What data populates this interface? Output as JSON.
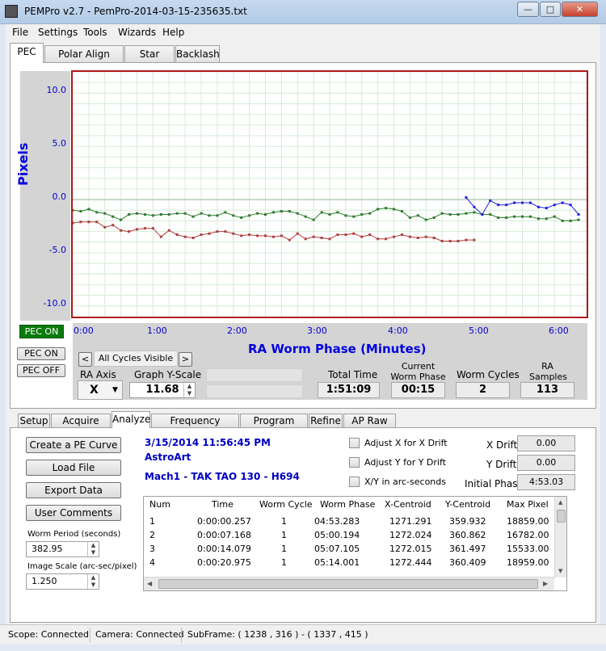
{
  "window": {
    "title": "PEMPro v2.7 - PemPro-2014-03-15-235635.txt",
    "min": "—",
    "max": "□",
    "close": "✕"
  },
  "menu": [
    "File",
    "Settings",
    "Tools",
    "Wizards",
    "Help"
  ],
  "main_tabs": [
    "PEC",
    "Polar Align Wizard",
    "Star Finder",
    "Backlash"
  ],
  "chart": {
    "ylabel": "Pixels",
    "xlabel": "RA Worm Phase (Minutes)",
    "yticks": [
      "10.0",
      "5.0",
      "0.0",
      "-5.0",
      "-10.0"
    ],
    "xticks": [
      "0:00",
      "1:00",
      "2:00",
      "3:00",
      "4:00",
      "5:00",
      "6:00"
    ]
  },
  "chart_data": {
    "type": "line",
    "title": "",
    "xlabel": "RA Worm Phase (Minutes)",
    "ylabel": "Pixels",
    "xlim": [
      0,
      6.4
    ],
    "ylim": [
      -11,
      12
    ],
    "grid": true,
    "series": [
      {
        "color": "#2e7d2e",
        "x": [
          0,
          0.1,
          0.2,
          0.3,
          0.4,
          0.5,
          0.6,
          0.7,
          0.8,
          0.9,
          1.0,
          1.1,
          1.2,
          1.3,
          1.4,
          1.5,
          1.6,
          1.7,
          1.8,
          1.9,
          2.0,
          2.1,
          2.2,
          2.3,
          2.4,
          2.5,
          2.6,
          2.7,
          2.8,
          2.9,
          3.0,
          3.1,
          3.2,
          3.3,
          3.4,
          3.5,
          3.6,
          3.7,
          3.8,
          3.9,
          4.0,
          4.1,
          4.2,
          4.3,
          4.4,
          4.5,
          4.6,
          4.7,
          4.8,
          4.9,
          5.0,
          5.1,
          5.2,
          5.3,
          5.4,
          5.5,
          5.6,
          5.7,
          5.8,
          5.9,
          6.0,
          6.1,
          6.2,
          6.3
        ],
        "y": [
          -1.0,
          -1.1,
          -0.9,
          -1.2,
          -1.3,
          -1.6,
          -1.9,
          -1.4,
          -1.3,
          -1.4,
          -1.5,
          -1.4,
          -1.4,
          -1.3,
          -1.3,
          -1.6,
          -1.3,
          -1.5,
          -1.5,
          -1.2,
          -1.5,
          -1.7,
          -1.5,
          -1.3,
          -1.4,
          -1.2,
          -1.1,
          -1.1,
          -1.3,
          -1.6,
          -1.9,
          -1.2,
          -1.4,
          -1.2,
          -1.5,
          -1.6,
          -1.4,
          -1.3,
          -0.9,
          -0.8,
          -0.9,
          -1.1,
          -1.7,
          -1.5,
          -1.9,
          -1.7,
          -1.3,
          -1.4,
          -1.4,
          -1.3,
          -1.2,
          -1.4,
          -1.4,
          -1.7,
          -1.7,
          -1.6,
          -1.6,
          -1.6,
          -1.8,
          -1.8,
          -1.6,
          -2.0,
          -2.0,
          -1.9
        ]
      },
      {
        "color": "#b04040",
        "x": [
          0,
          0.1,
          0.2,
          0.3,
          0.4,
          0.5,
          0.6,
          0.7,
          0.8,
          0.9,
          1.0,
          1.1,
          1.2,
          1.3,
          1.4,
          1.5,
          1.6,
          1.7,
          1.8,
          1.9,
          2.0,
          2.1,
          2.2,
          2.3,
          2.4,
          2.5,
          2.6,
          2.7,
          2.8,
          2.9,
          3.0,
          3.1,
          3.2,
          3.3,
          3.4,
          3.5,
          3.6,
          3.7,
          3.8,
          3.9,
          4.0,
          4.1,
          4.2,
          4.3,
          4.4,
          4.5,
          4.6,
          4.7,
          4.8,
          4.9,
          5.0
        ],
        "y": [
          -2.2,
          -2.1,
          -2.1,
          -2.1,
          -2.6,
          -2.4,
          -2.9,
          -3.0,
          -2.8,
          -2.7,
          -2.7,
          -3.5,
          -2.9,
          -3.3,
          -3.5,
          -3.6,
          -3.3,
          -3.2,
          -3.0,
          -3.0,
          -3.2,
          -3.4,
          -3.3,
          -3.4,
          -3.4,
          -3.5,
          -3.4,
          -3.8,
          -3.2,
          -3.7,
          -3.5,
          -3.6,
          -3.7,
          -3.3,
          -3.3,
          -3.2,
          -3.5,
          -3.3,
          -3.7,
          -3.7,
          -3.5,
          -3.3,
          -3.5,
          -3.6,
          -3.5,
          -3.6,
          -3.9,
          -3.9,
          -3.9,
          -3.8,
          -3.8
        ]
      },
      {
        "color": "#2020e0",
        "x": [
          4.9,
          5.0,
          5.1,
          5.2,
          5.3,
          5.4,
          5.5,
          5.6,
          5.7,
          5.8,
          5.9,
          6.0,
          6.1,
          6.2,
          6.3
        ],
        "y": [
          0.2,
          -0.7,
          -1.4,
          -0.1,
          -0.5,
          -0.5,
          -0.3,
          -0.3,
          -0.3,
          -0.7,
          -0.8,
          -0.5,
          -0.3,
          -0.5,
          -1.4
        ]
      }
    ]
  },
  "pec": {
    "status": "PEC ON",
    "on_button": "PEC ON",
    "off_button": "PEC OFF",
    "prev": "<",
    "next": ">",
    "cycles": "All Cycles Visible",
    "axis_label": "RA Axis",
    "axis_value": "X",
    "yscale_label": "Graph Y-Scale",
    "yscale_value": "11.68",
    "total_time_label": "Total Time",
    "total_time": "1:51:09",
    "worm_phase_label": "Current Worm Phase",
    "worm_phase": "00:15",
    "worm_cycles_label": "Worm Cycles",
    "worm_cycles": "2",
    "ra_samples_label": "RA Samples",
    "ra_samples": "113"
  },
  "sub_tabs": [
    "Setup",
    "Acquire Data",
    "Analyze",
    "Frequency Spectrum",
    "Program Mount",
    "Refine",
    "AP Raw PE"
  ],
  "analyze": {
    "create_button": "Create a PE Curve",
    "load_button": "Load File",
    "export_button": "Export Data",
    "comments_button": "User Comments",
    "worm_period_label": "Worm Period (seconds)",
    "worm_period": "382.95",
    "image_scale_label": "Image Scale (arc-sec/pixel)",
    "image_scale": "1.250",
    "date": "3/15/2014 11:56:45 PM",
    "software": "AstroArt",
    "setup": "Mach1 - TAK TAO 130 - H694",
    "adjust_x": "Adjust X for X Drift",
    "adjust_y": "Adjust Y for Y Drift",
    "xy_arcsec": "X/Y in arc-seconds",
    "x_drift_label": "X Drift",
    "x_drift": "0.00",
    "y_drift_label": "Y Drift",
    "y_drift": "0.00",
    "initial_phase_label": "Initial Phase",
    "initial_phase": "4:53.03"
  },
  "table": {
    "columns": [
      "Num",
      "Time",
      "Worm Cycle",
      "Worm Phase",
      "X-Centroid",
      "Y-Centroid",
      "Max Pixel"
    ],
    "rows": [
      [
        "1",
        "0:00:00.257",
        "1",
        "04:53.283",
        "1271.291",
        "359.932",
        "18859.00"
      ],
      [
        "2",
        "0:00:07.168",
        "1",
        "05:00.194",
        "1272.024",
        "360.862",
        "16782.00"
      ],
      [
        "3",
        "0:00:14.079",
        "1",
        "05:07.105",
        "1272.015",
        "361.497",
        "15533.00"
      ],
      [
        "4",
        "0:00:20.975",
        "1",
        "05:14.001",
        "1272.444",
        "360.409",
        "18959.00"
      ]
    ]
  },
  "status": {
    "scope": "Scope: Connected",
    "camera": "Camera: Connected",
    "subframe": "SubFrame: ( 1238 , 316 ) - ( 1337 , 415 )"
  }
}
